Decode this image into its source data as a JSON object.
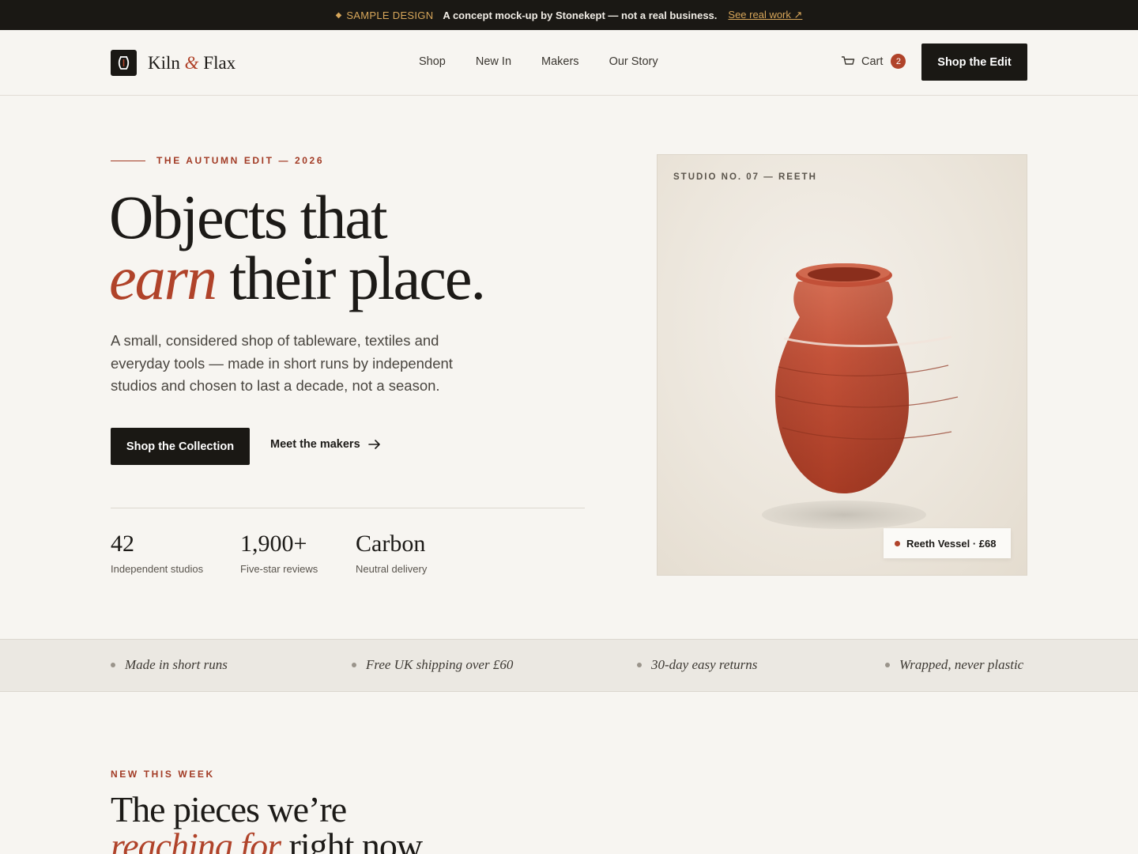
{
  "banner": {
    "tag": "SAMPLE DESIGN",
    "message": "A concept mock-up by Stonekept — not a real business.",
    "link": "See real work ↗"
  },
  "brand": {
    "name_part1": "Kiln",
    "ampersand": "&",
    "name_part2": "Flax"
  },
  "nav": [
    "Shop",
    "New In",
    "Makers",
    "Our Story"
  ],
  "cart": {
    "label": "Cart",
    "count": "2"
  },
  "header_cta": "Shop the Edit",
  "hero": {
    "eyebrow": "THE AUTUMN EDIT — 2026",
    "headline_line1": "Objects that",
    "headline_accent": "earn",
    "headline_rest": " their place.",
    "lede": "A small, considered shop of tableware, textiles and everyday tools — made in short runs by independent studios and chosen to last a decade, not a season.",
    "primary_cta": "Shop the Collection",
    "secondary_cta": "Meet the makers"
  },
  "stats": [
    {
      "value": "42",
      "label": "Independent studios"
    },
    {
      "value": "1,900+",
      "label": "Five-star reviews"
    },
    {
      "value": "Carbon",
      "label": "Neutral delivery"
    }
  ],
  "feature_card": {
    "studio": "STUDIO NO. 07 — REETH",
    "product": "Reeth Vessel · £68"
  },
  "benefits": [
    "Made in short runs",
    "Free UK shipping over £60",
    "30-day easy returns",
    "Wrapped, never plastic"
  ],
  "new_section": {
    "eyebrow": "NEW THIS WEEK",
    "title_line1": "The pieces we’re",
    "title_accent": "reaching for",
    "title_rest": " right now."
  },
  "colors": {
    "accent": "#b0432a",
    "dark": "#1a1814",
    "background": "#f7f5f1",
    "gold": "#d7a65a"
  }
}
